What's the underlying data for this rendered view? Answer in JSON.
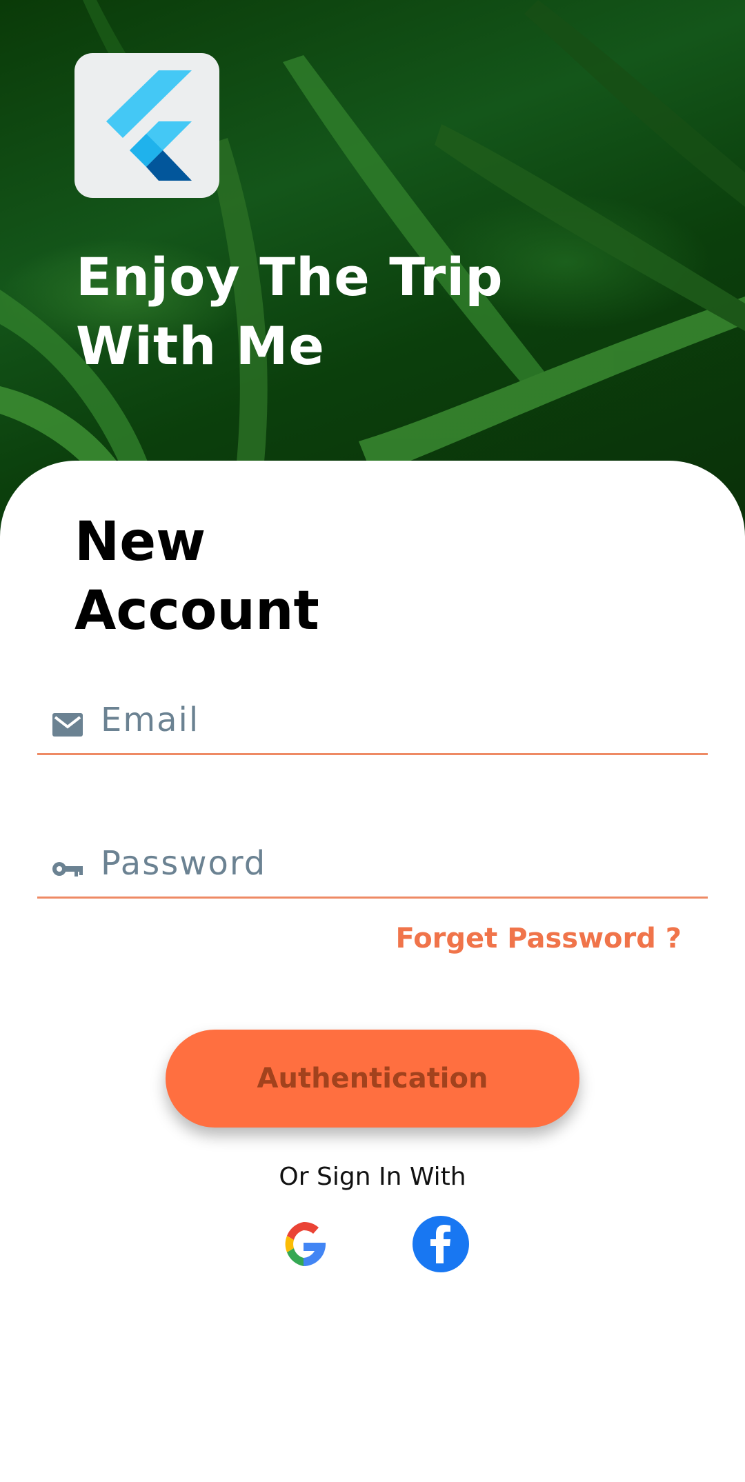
{
  "hero": {
    "title": "Enjoy The Trip\n With Me",
    "logo_icon": "flutter-logo-icon"
  },
  "form": {
    "title": "New\nAccount",
    "email": {
      "placeholder": "Email",
      "value": "",
      "icon": "mail-icon"
    },
    "password": {
      "placeholder": "Password",
      "value": "",
      "icon": "key-icon"
    },
    "forgot_label": "Forget Password ?",
    "submit_label": "Authentication",
    "alt_signin_label": "Or Sign In With",
    "social": [
      {
        "name": "google-icon"
      },
      {
        "name": "facebook-icon"
      }
    ]
  },
  "colors": {
    "accent": "#ff6f40",
    "accent_text": "#a2421d",
    "link": "#f0744a",
    "field_line": "#ee8a64",
    "placeholder": "#6b8292",
    "facebook": "#1877f2"
  }
}
